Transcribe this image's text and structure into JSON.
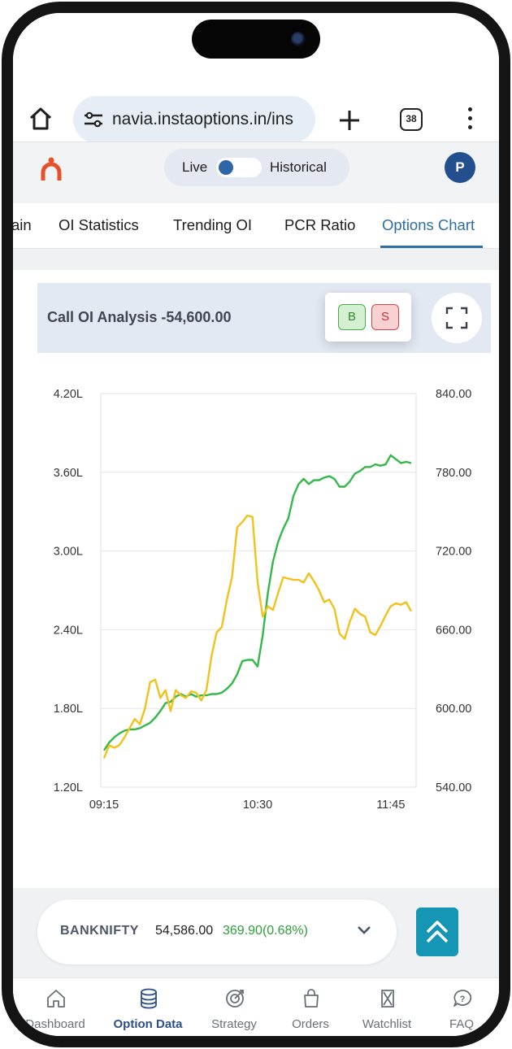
{
  "browser": {
    "url": "navia.instaoptions.in/ins",
    "tab_count": "38"
  },
  "header": {
    "live_label": "Live",
    "historical_label": "Historical",
    "avatar_initial": "P",
    "mode": "live"
  },
  "tabs": [
    {
      "label": "ain"
    },
    {
      "label": "OI Statistics"
    },
    {
      "label": "Trending OI"
    },
    {
      "label": "PCR Ratio"
    },
    {
      "label": "Options Chart",
      "active": true
    }
  ],
  "card": {
    "title": "Call OI Analysis -54,600.00",
    "buy_label": "B",
    "sell_label": "S"
  },
  "chart_data": {
    "type": "line",
    "x_ticks": [
      "09:15",
      "10:30",
      "11:45"
    ],
    "y_left_ticks": [
      "4.20L",
      "3.60L",
      "3.00L",
      "2.40L",
      "1.80L",
      "1.20L"
    ],
    "y_right_ticks": [
      "840.00",
      "780.00",
      "720.00",
      "660.00",
      "600.00",
      "540.00"
    ],
    "ylim_left": [
      1.2,
      4.2
    ],
    "ylim_right": [
      540,
      840
    ],
    "grid": true,
    "series": [
      {
        "axis": "left",
        "color": "#35b84a",
        "values": [
          1.48,
          1.54,
          1.58,
          1.61,
          1.63,
          1.64,
          1.64,
          1.65,
          1.67,
          1.69,
          1.73,
          1.78,
          1.84,
          1.85,
          1.89,
          1.91,
          1.89,
          1.91,
          1.89,
          1.9,
          1.9,
          1.91,
          1.91,
          1.92,
          1.95,
          1.99,
          2.06,
          2.16,
          2.17,
          2.17,
          2.12,
          2.36,
          2.68,
          2.92,
          3.07,
          3.17,
          3.25,
          3.42,
          3.51,
          3.55,
          3.51,
          3.54,
          3.54,
          3.56,
          3.57,
          3.55,
          3.49,
          3.49,
          3.53,
          3.59,
          3.61,
          3.64,
          3.64,
          3.66,
          3.65,
          3.66,
          3.73,
          3.7,
          3.67,
          3.68,
          3.67
        ]
      },
      {
        "axis": "right",
        "color": "#f1c21b",
        "values": [
          562,
          572,
          570,
          572,
          578,
          585,
          592,
          588,
          600,
          620,
          622,
          608,
          614,
          598,
          614,
          610,
          608,
          613,
          612,
          606,
          614,
          640,
          658,
          662,
          683,
          700,
          738,
          742,
          747,
          746,
          696,
          670,
          678,
          675,
          688,
          700,
          699,
          698,
          698,
          696,
          703,
          697,
          690,
          681,
          683,
          676,
          657,
          653,
          666,
          676,
          672,
          670,
          658,
          656,
          663,
          671,
          678,
          680,
          679,
          681,
          674
        ]
      }
    ]
  },
  "symbol_bar": {
    "name": "BANKNIFTY",
    "price": "54,586.00",
    "change": "369.90(0.68%)"
  },
  "bottom_nav": [
    {
      "label": "Dashboard",
      "icon": "home-icon"
    },
    {
      "label": "Option Data",
      "icon": "database-icon",
      "active": true
    },
    {
      "label": "Strategy",
      "icon": "target-icon"
    },
    {
      "label": "Orders",
      "icon": "bag-icon"
    },
    {
      "label": "Watchlist",
      "icon": "hourglass-icon"
    },
    {
      "label": "FAQ",
      "icon": "faq-icon"
    }
  ]
}
